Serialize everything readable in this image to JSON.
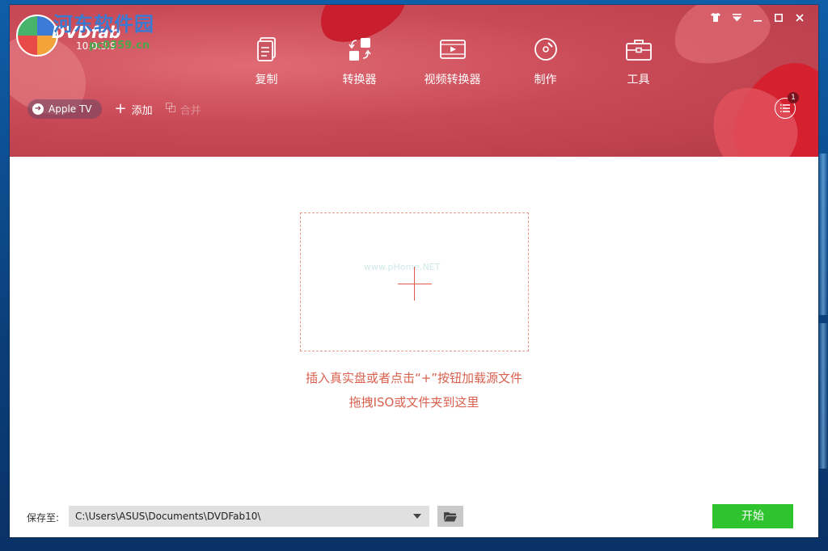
{
  "app": {
    "brand": "DVDfab",
    "version": "10.0.3.9",
    "watermark_title": "河东软件园",
    "watermark_url": "pc0359.cn"
  },
  "window_controls": [
    {
      "name": "skin-icon",
      "glyph": "👕"
    },
    {
      "name": "dropdown-icon",
      "glyph": "⏷"
    },
    {
      "name": "minimize-icon",
      "glyph": "—"
    },
    {
      "name": "maximize-icon",
      "glyph": "□"
    },
    {
      "name": "close-icon",
      "glyph": "✕"
    }
  ],
  "nav": [
    {
      "label": "复制",
      "icon": "copy-icon"
    },
    {
      "label": "转换器",
      "icon": "converter-icon"
    },
    {
      "label": "视频转换器",
      "icon": "video-converter-icon"
    },
    {
      "label": "制作",
      "icon": "creator-icon"
    },
    {
      "label": "工具",
      "icon": "toolbox-icon"
    }
  ],
  "toolbar": {
    "device_label": "Apple TV",
    "add_label": "添加",
    "merge_label": "合并"
  },
  "queue": {
    "badge": "1"
  },
  "dropzone": {
    "watermark": "www.pHome.NET"
  },
  "hints": {
    "line1": "插入真实盘或者点击“+”按钮加载源文件",
    "line2": "拖拽ISO或文件夹到这里"
  },
  "bottom": {
    "save_label": "保存至:",
    "path": "C:\\Users\\ASUS\\Documents\\DVDFab10\\",
    "start_label": "开始"
  },
  "colors": {
    "header": "#c94a57",
    "hint_text": "#d9614f",
    "start_button": "#2fc42f"
  }
}
